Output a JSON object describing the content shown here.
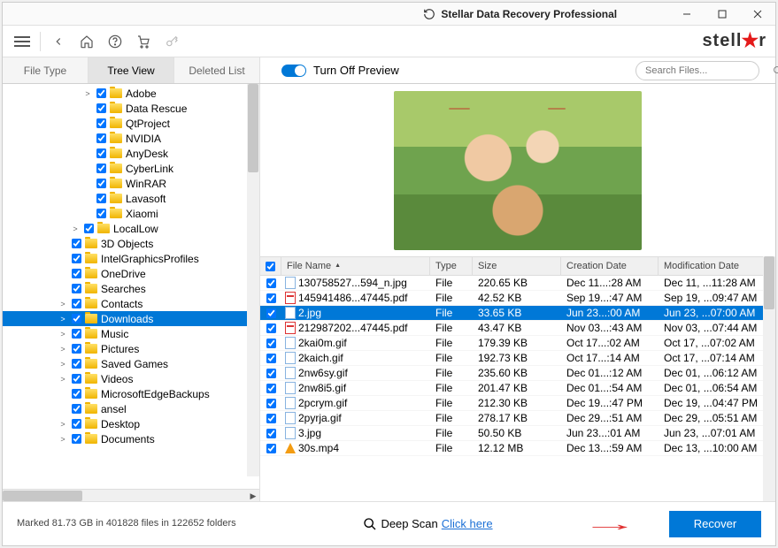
{
  "window": {
    "title": "Stellar Data Recovery Professional"
  },
  "brand": {
    "pre": "stell",
    "post": "r"
  },
  "tabs": {
    "items": [
      {
        "label": "File Type"
      },
      {
        "label": "Tree View"
      },
      {
        "label": "Deleted List"
      }
    ],
    "active_index": 1
  },
  "preview_toggle": {
    "label": "Turn Off Preview",
    "on": true
  },
  "search": {
    "placeholder": "Search Files..."
  },
  "tree": [
    {
      "depth": 6,
      "arrow": ">",
      "label": "Adobe"
    },
    {
      "depth": 6,
      "arrow": "",
      "label": "Data Rescue"
    },
    {
      "depth": 6,
      "arrow": "",
      "label": "QtProject"
    },
    {
      "depth": 6,
      "arrow": "",
      "label": "NVIDIA"
    },
    {
      "depth": 6,
      "arrow": "",
      "label": "AnyDesk"
    },
    {
      "depth": 6,
      "arrow": "",
      "label": "CyberLink"
    },
    {
      "depth": 6,
      "arrow": "",
      "label": "WinRAR"
    },
    {
      "depth": 6,
      "arrow": "",
      "label": "Lavasoft"
    },
    {
      "depth": 6,
      "arrow": "",
      "label": "Xiaomi"
    },
    {
      "depth": 5,
      "arrow": ">",
      "label": "LocalLow"
    },
    {
      "depth": 4,
      "arrow": "",
      "label": "3D Objects"
    },
    {
      "depth": 4,
      "arrow": "",
      "label": "IntelGraphicsProfiles"
    },
    {
      "depth": 4,
      "arrow": "",
      "label": "OneDrive"
    },
    {
      "depth": 4,
      "arrow": "",
      "label": "Searches"
    },
    {
      "depth": 4,
      "arrow": ">",
      "label": "Contacts"
    },
    {
      "depth": 4,
      "arrow": ">",
      "label": "Downloads",
      "selected": true
    },
    {
      "depth": 4,
      "arrow": ">",
      "label": "Music"
    },
    {
      "depth": 4,
      "arrow": ">",
      "label": "Pictures"
    },
    {
      "depth": 4,
      "arrow": ">",
      "label": "Saved Games"
    },
    {
      "depth": 4,
      "arrow": ">",
      "label": "Videos"
    },
    {
      "depth": 4,
      "arrow": "",
      "label": "MicrosoftEdgeBackups"
    },
    {
      "depth": 4,
      "arrow": "",
      "label": "ansel"
    },
    {
      "depth": 4,
      "arrow": ">",
      "label": "Desktop"
    },
    {
      "depth": 4,
      "arrow": ">",
      "label": "Documents"
    }
  ],
  "grid": {
    "columns": [
      "File Name",
      "Type",
      "Size",
      "Creation Date",
      "Modification Date"
    ],
    "sort_col": 0,
    "rows": [
      {
        "icon": "jpg",
        "name": "130758527...594_n.jpg",
        "type": "File",
        "size": "220.65 KB",
        "cdate": "Dec 11...:28 AM",
        "mdate": "Dec 11, ...11:28 AM"
      },
      {
        "icon": "pdf",
        "name": "145941486...47445.pdf",
        "type": "File",
        "size": "42.52 KB",
        "cdate": "Sep 19...:47 AM",
        "mdate": "Sep 19, ...09:47 AM"
      },
      {
        "icon": "jpg",
        "name": "2.jpg",
        "type": "File",
        "size": "33.65 KB",
        "cdate": "Jun 23...:00 AM",
        "mdate": "Jun 23, ...07:00 AM",
        "selected": true
      },
      {
        "icon": "pdf",
        "name": "212987202...47445.pdf",
        "type": "File",
        "size": "43.47 KB",
        "cdate": "Nov 03...:43 AM",
        "mdate": "Nov 03, ...07:44 AM"
      },
      {
        "icon": "gif",
        "name": "2kai0m.gif",
        "type": "File",
        "size": "179.39 KB",
        "cdate": "Oct 17...:02 AM",
        "mdate": "Oct 17, ...07:02 AM"
      },
      {
        "icon": "gif",
        "name": "2kaich.gif",
        "type": "File",
        "size": "192.73 KB",
        "cdate": "Oct 17...:14 AM",
        "mdate": "Oct 17, ...07:14 AM"
      },
      {
        "icon": "gif",
        "name": "2nw6sy.gif",
        "type": "File",
        "size": "235.60 KB",
        "cdate": "Dec 01...:12 AM",
        "mdate": "Dec 01, ...06:12 AM"
      },
      {
        "icon": "gif",
        "name": "2nw8i5.gif",
        "type": "File",
        "size": "201.47 KB",
        "cdate": "Dec 01...:54 AM",
        "mdate": "Dec 01, ...06:54 AM"
      },
      {
        "icon": "gif",
        "name": "2pcrym.gif",
        "type": "File",
        "size": "212.30 KB",
        "cdate": "Dec 19...:47 PM",
        "mdate": "Dec 19, ...04:47 PM"
      },
      {
        "icon": "gif",
        "name": "2pyrja.gif",
        "type": "File",
        "size": "278.17 KB",
        "cdate": "Dec 29...:51 AM",
        "mdate": "Dec 29, ...05:51 AM"
      },
      {
        "icon": "jpg",
        "name": "3.jpg",
        "type": "File",
        "size": "50.50 KB",
        "cdate": "Jun 23...:01 AM",
        "mdate": "Jun 23, ...07:01 AM"
      },
      {
        "icon": "vlc",
        "name": "30s.mp4",
        "type": "File",
        "size": "12.12 MB",
        "cdate": "Dec 13...:59 AM",
        "mdate": "Dec 13, ...10:00 AM"
      }
    ]
  },
  "status": {
    "text": "Marked 81.73 GB in 401828 files in 122652 folders"
  },
  "deep_scan": {
    "label": "Deep Scan",
    "link": "Click here"
  },
  "recover": {
    "label": "Recover"
  }
}
